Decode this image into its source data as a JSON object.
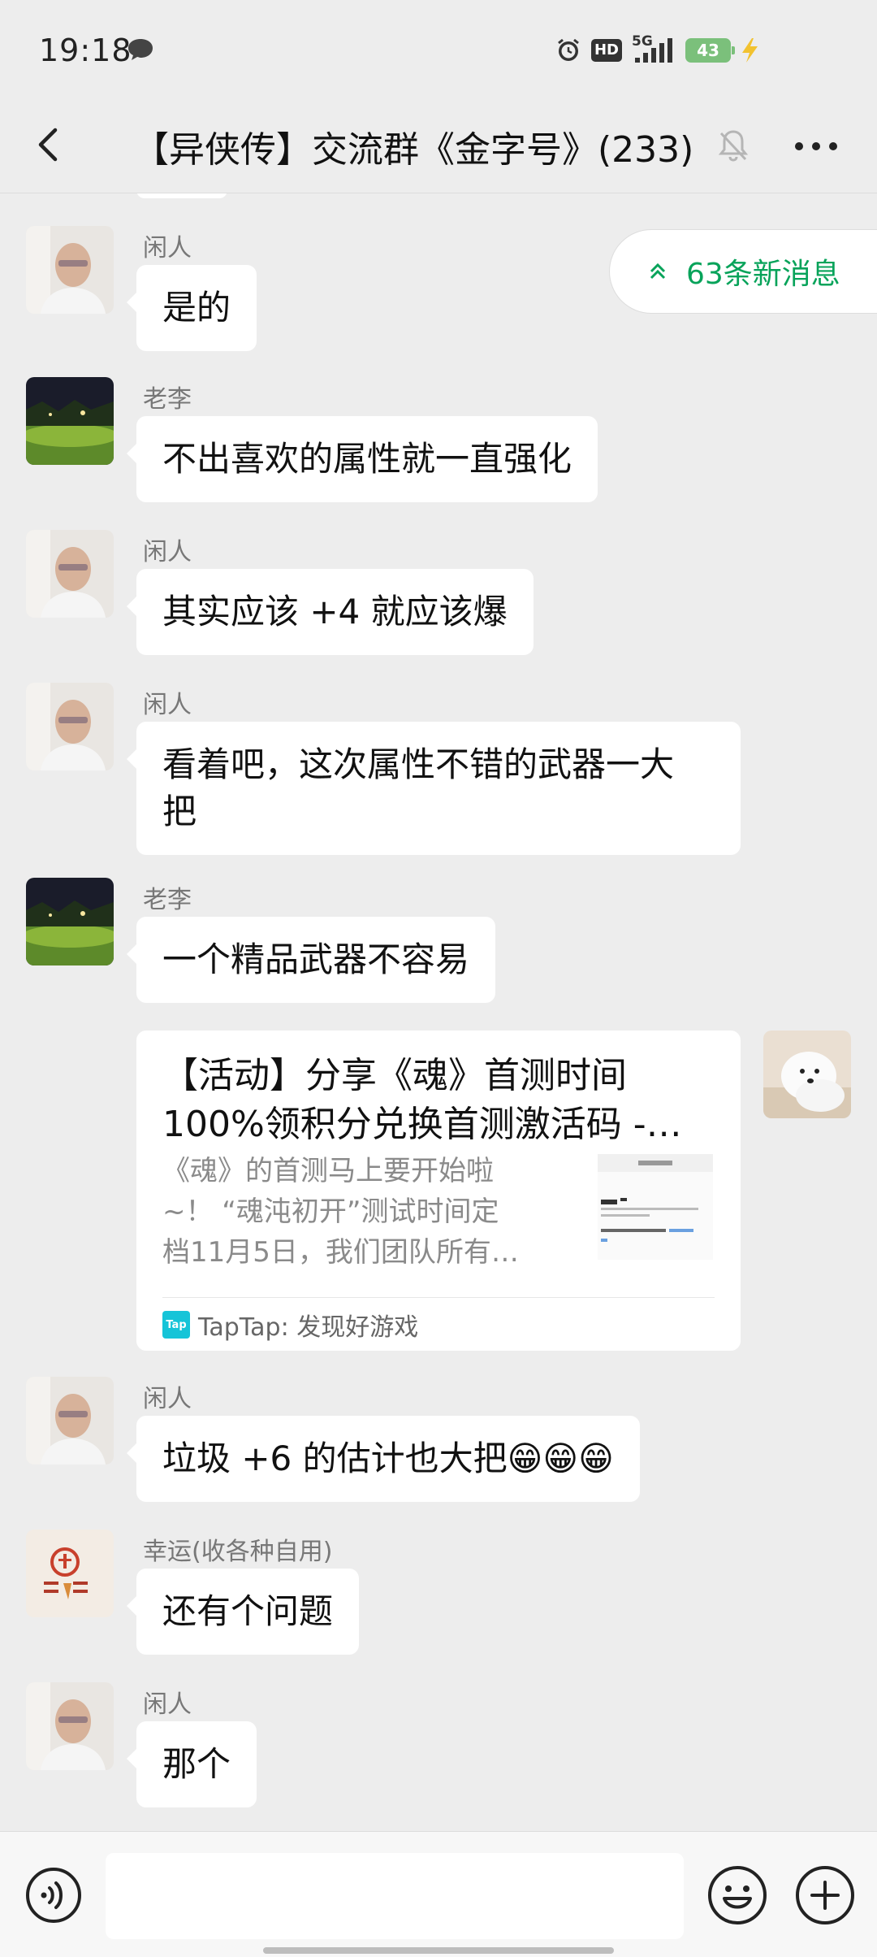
{
  "status_bar": {
    "time": "19:18",
    "hd_label": "HD",
    "network_label": "5G",
    "battery_level": "43"
  },
  "header": {
    "title": "【异侠传】交流群《金字号》(233)"
  },
  "new_messages": {
    "label": "63条新消息"
  },
  "messages": [
    {
      "sender": "闲人",
      "text": "是的",
      "avatar": "person-avatar"
    },
    {
      "sender": "老李",
      "text": "不出喜欢的属性就一直强化",
      "avatar": "night-lawn-avatar"
    },
    {
      "sender": "闲人",
      "text": "其实应该 +4 就应该爆",
      "avatar": "person-avatar"
    },
    {
      "sender": "闲人",
      "text_lines": [
        "看着吧，这次属性不错的武器一大",
        "把"
      ],
      "avatar": "person-avatar"
    },
    {
      "sender": "老李",
      "text": "一个精品武器不容易",
      "avatar": "night-lawn-avatar"
    },
    {
      "sender": "闲人",
      "text": "垃圾 +6 的估计也大把😁😁😁",
      "avatar": "person-avatar"
    },
    {
      "sender": "幸运(收各种自用)",
      "text": "还有个问题",
      "avatar": "red-seal-avatar"
    },
    {
      "sender": "闲人",
      "text": "那个",
      "avatar": "person-avatar"
    }
  ],
  "link_card": {
    "title_lines": [
      "【活动】分享《魂》首测时间",
      "100%领积分兑换首测激活码 -…"
    ],
    "desc_lines": [
      "《魂》的首测马上要开始啦",
      "~！ “魂沌初开”测试时间定",
      "档11月5日，我们团队所有…"
    ],
    "source": "TapTap: 发现好游戏",
    "source_logo_text": "Tap",
    "avatar": "white-dog-avatar"
  },
  "colors": {
    "background": "#ededed",
    "bubble": "#ffffff",
    "accent_green": "#07a35a",
    "sender_gray": "#777777"
  },
  "icons": {
    "back": "chevron-left-icon",
    "mute": "bell-off-icon",
    "more": "more-dots-icon",
    "voice": "voice-icon",
    "emoji": "emoji-icon",
    "plus": "plus-icon"
  }
}
